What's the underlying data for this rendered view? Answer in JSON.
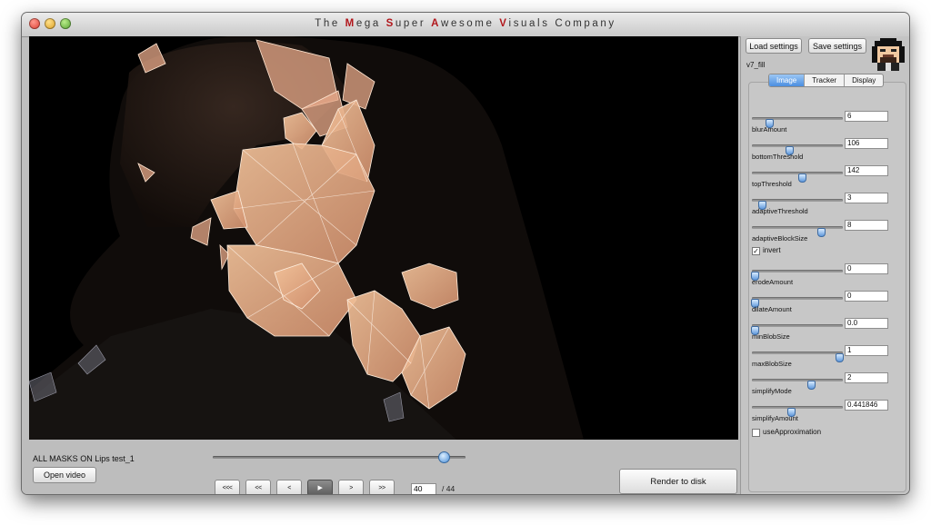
{
  "window": {
    "title_parts": [
      {
        "text": "The ",
        "hl": false
      },
      {
        "text": "M",
        "hl": true
      },
      {
        "text": "ega ",
        "hl": false
      },
      {
        "text": "S",
        "hl": true
      },
      {
        "text": "uper ",
        "hl": false
      },
      {
        "text": "A",
        "hl": true
      },
      {
        "text": "wesome ",
        "hl": false
      },
      {
        "text": "V",
        "hl": true
      },
      {
        "text": "isuals ",
        "hl": false
      },
      {
        "text": "Company",
        "hl": false
      }
    ]
  },
  "player": {
    "clip_label": "ALL MASKS ON Lips test_1",
    "open_video": "Open video",
    "render": "Render to disk",
    "transport": [
      {
        "name": "first-frame-button",
        "label": "<<<"
      },
      {
        "name": "rewind-button",
        "label": "<<"
      },
      {
        "name": "step-back-button",
        "label": "<"
      },
      {
        "name": "play-button",
        "label": "▶",
        "active": true
      },
      {
        "name": "step-forward-button",
        "label": ">"
      },
      {
        "name": "fast-forward-button",
        "label": ">>"
      }
    ],
    "frame": "40",
    "total_frames": "/ 44",
    "scrub_position": 0.91
  },
  "panel": {
    "load_settings": "Load settings",
    "save_settings": "Save settings",
    "preset_name": "v7_fill",
    "tabs": [
      {
        "label": "Image",
        "active": true
      },
      {
        "label": "Tracker",
        "active": false
      },
      {
        "label": "Display",
        "active": false
      }
    ],
    "sliders": [
      {
        "id": "blurAmount",
        "label": "blurAmount",
        "value": "6",
        "pos": 0.2
      },
      {
        "id": "bottomThreshold",
        "label": "bottomThreshold",
        "value": "106",
        "pos": 0.42
      },
      {
        "id": "topThreshold",
        "label": "topThreshold",
        "value": "142",
        "pos": 0.56
      },
      {
        "id": "adaptiveThreshold",
        "label": "adaptiveThreshold",
        "value": "3",
        "pos": 0.12
      },
      {
        "id": "adaptiveBlockSize",
        "label": "adaptiveBlockSize",
        "value": "8",
        "pos": 0.77
      },
      {
        "id": "erodeAmount",
        "label": "erodeAmount",
        "value": "0",
        "pos": 0.04
      },
      {
        "id": "dilateAmount",
        "label": "dilateAmount",
        "value": "0",
        "pos": 0.04
      },
      {
        "id": "minBlobSize",
        "label": "minBlobSize",
        "value": "0.0",
        "pos": 0.04
      },
      {
        "id": "maxBlobSize",
        "label": "maxBlobSize",
        "value": "1",
        "pos": 0.97
      },
      {
        "id": "simplifyMode",
        "label": "simplifyMode",
        "value": "2",
        "pos": 0.66
      },
      {
        "id": "simplifyAmount",
        "label": "simplifyAmount",
        "value": "0.441846",
        "pos": 0.44
      }
    ],
    "invert": {
      "label": "invert",
      "checked": true
    },
    "useApproximation": {
      "label": "useApproximation",
      "checked": false
    }
  }
}
